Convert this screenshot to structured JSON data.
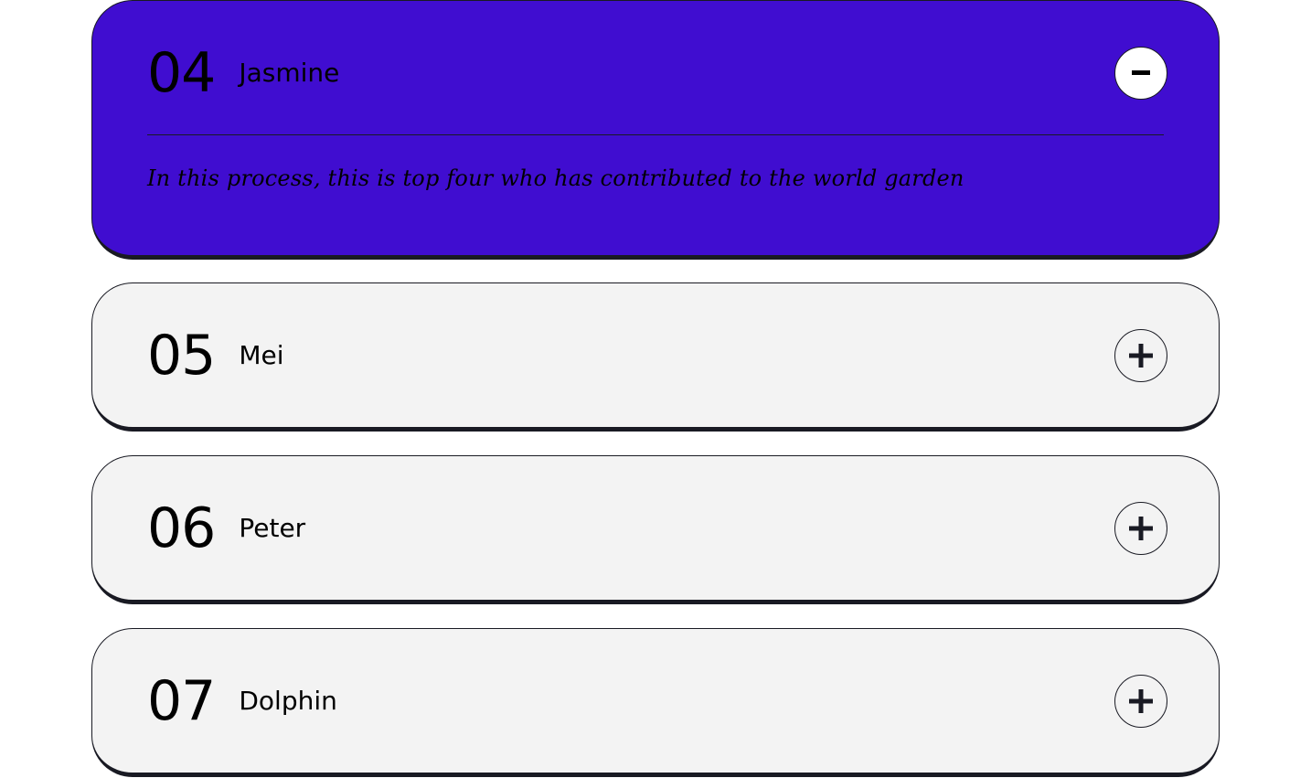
{
  "items": [
    {
      "number": "04",
      "name": "Jasmine",
      "expanded": true,
      "toggle_symbol": "minus-icon",
      "answer": "In this process, this is top four who has contributed to the world garden"
    },
    {
      "number": "05",
      "name": "Mei",
      "expanded": false,
      "toggle_symbol": "plus-icon"
    },
    {
      "number": "06",
      "name": "Peter",
      "expanded": false,
      "toggle_symbol": "plus-icon"
    },
    {
      "number": "07",
      "name": "Dolphin",
      "expanded": false,
      "toggle_symbol": "plus-icon"
    }
  ],
  "colors": {
    "expanded_background": "#400dd0",
    "collapsed_background": "#f3f3f3",
    "border": "#191a23",
    "text": "#000000"
  }
}
